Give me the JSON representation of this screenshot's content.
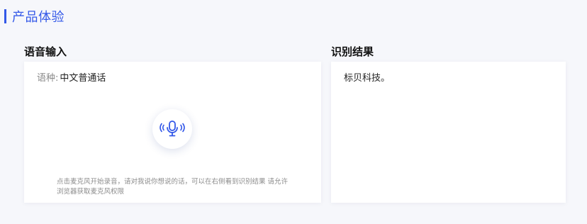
{
  "section": {
    "title": "产品体验"
  },
  "input_panel": {
    "heading": "语音输入",
    "language_label": "语种:",
    "language_value": "中文普通话",
    "mic_icon": "microphone-icon",
    "hint": "点击麦克风开始录音，请对我说你想说的话，可以在右侧看到识别结果 请允许浏览器获取麦克风权限"
  },
  "result_panel": {
    "heading": "识别结果",
    "text": "标贝科技。"
  },
  "colors": {
    "accent": "#3358e8",
    "background": "#f6f7fb",
    "panel": "#ffffff"
  }
}
